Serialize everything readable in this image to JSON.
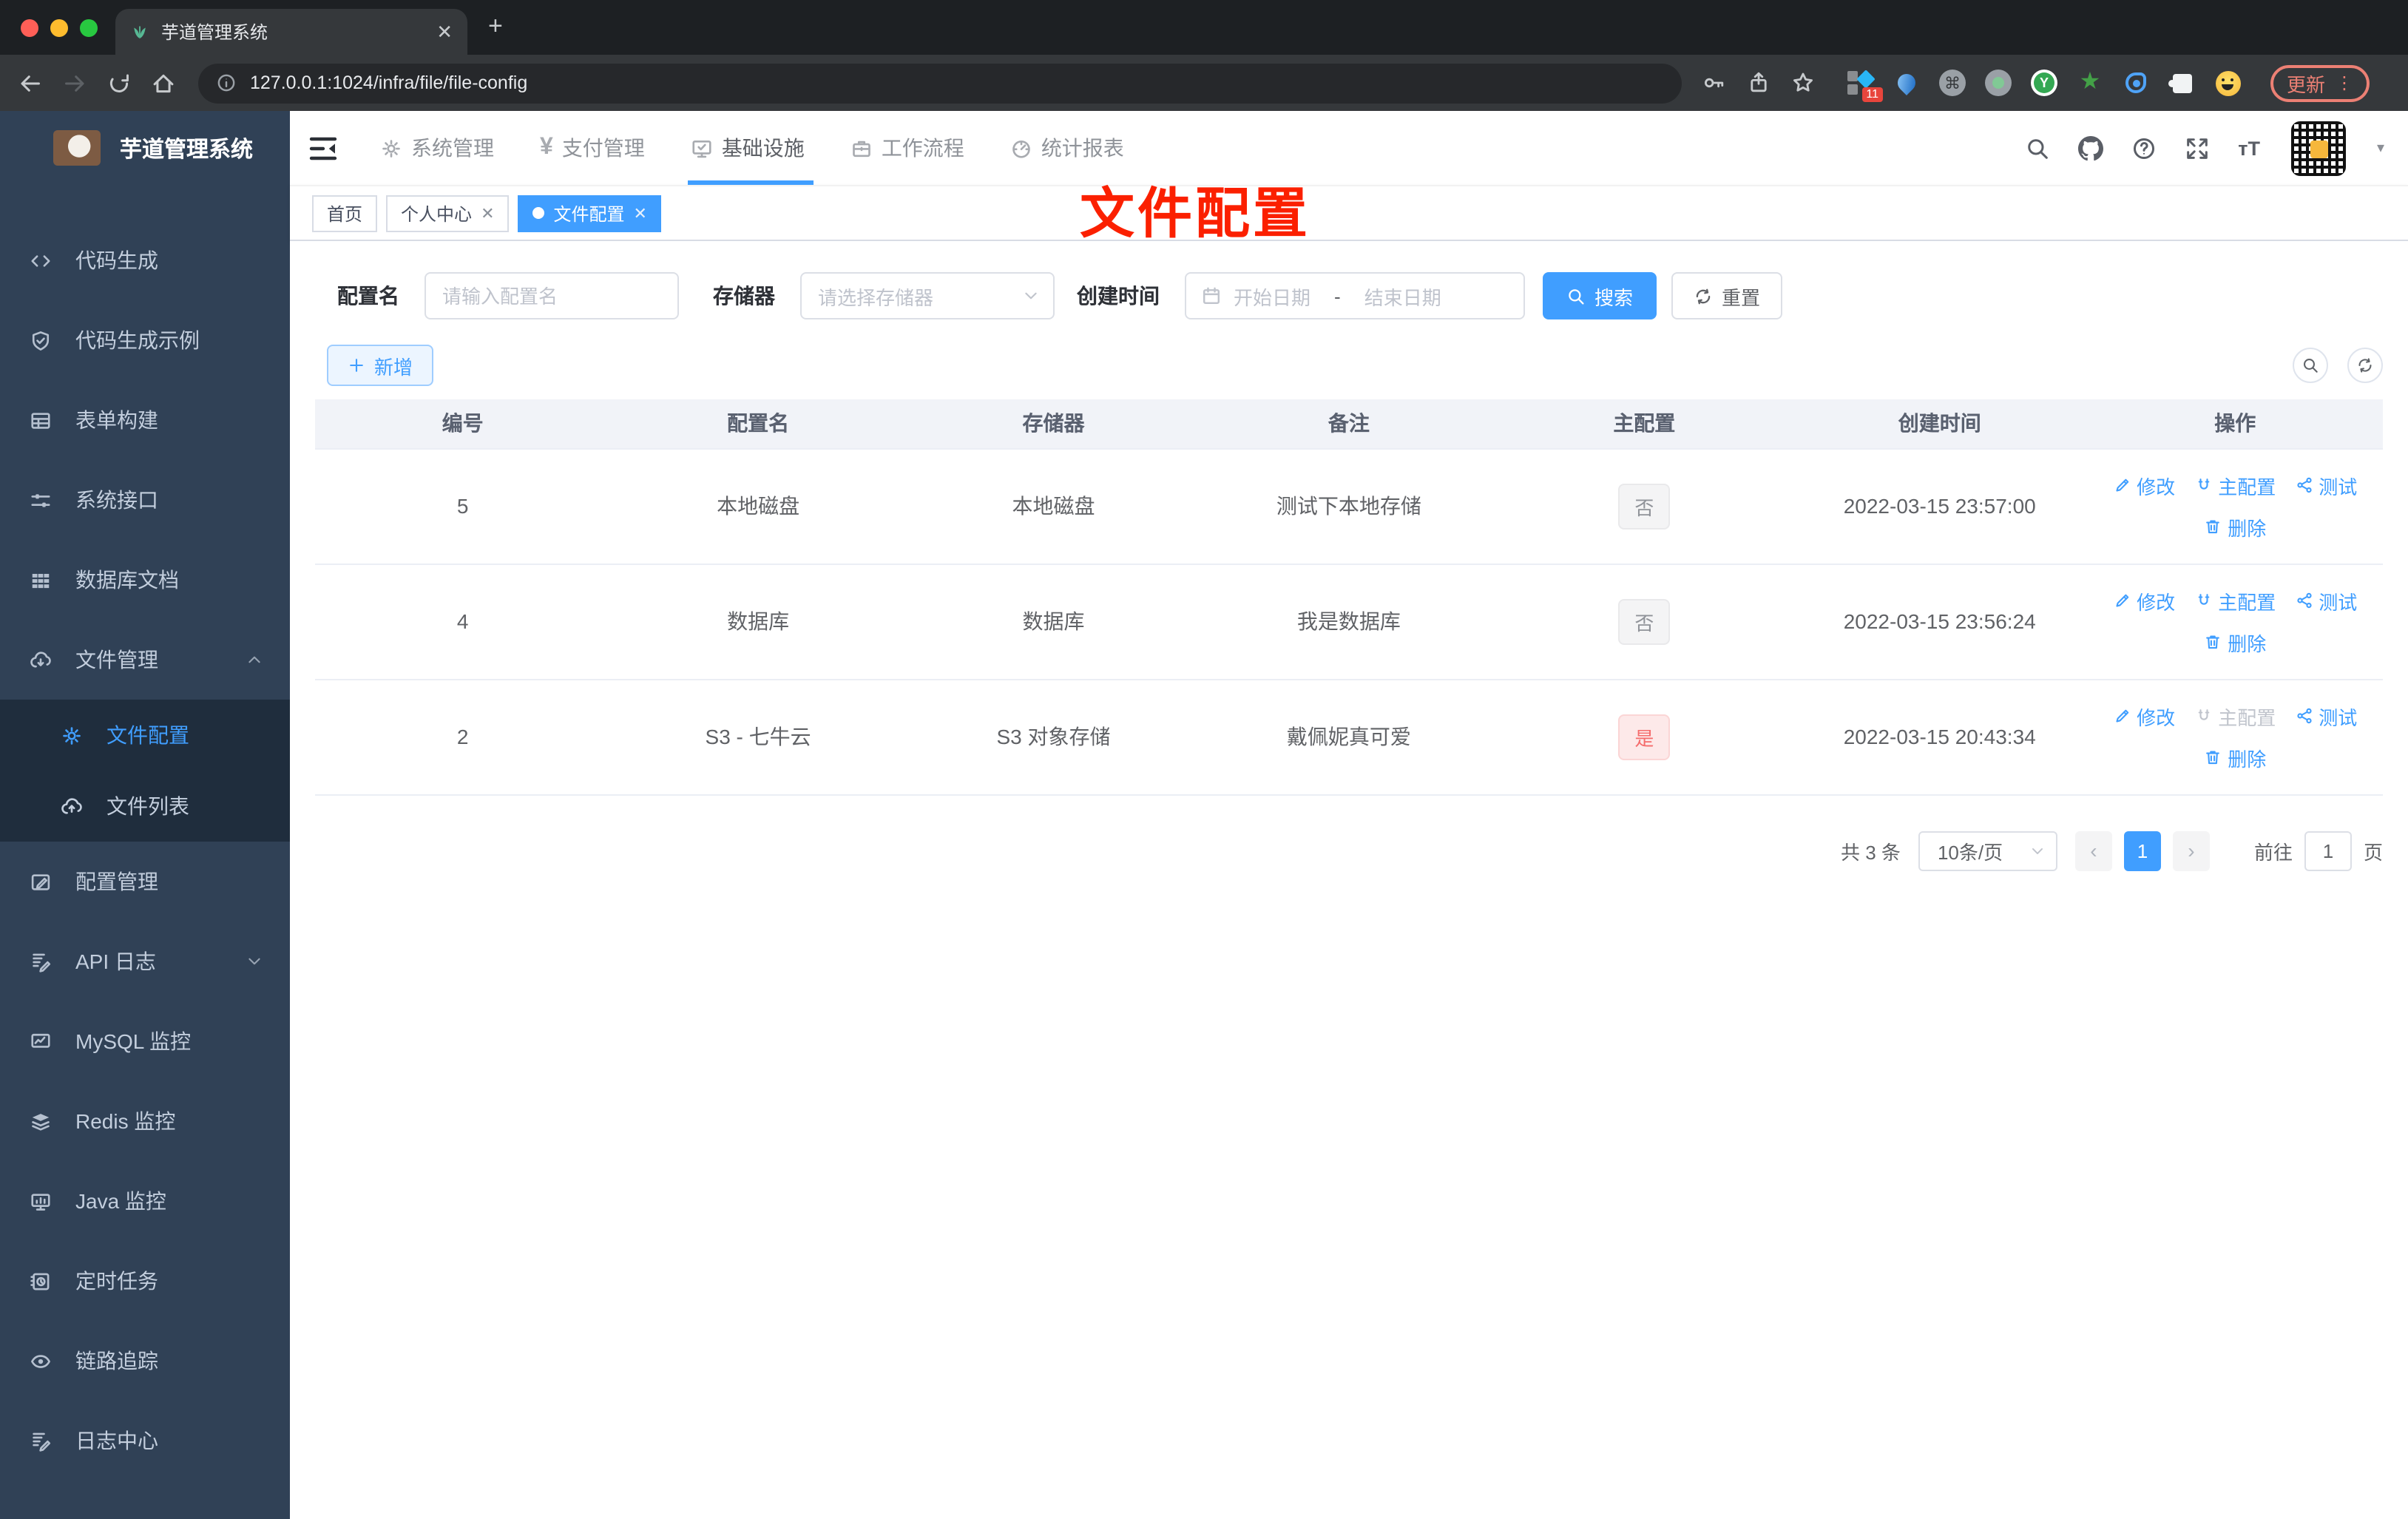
{
  "browser": {
    "tab_title": "芋道管理系统",
    "url": "127.0.0.1:1024/infra/file/file-config",
    "update_label": "更新",
    "extension_badge": "11"
  },
  "colors": {
    "accent": "#409eff",
    "danger": "#f56c6c",
    "sidebar_bg": "#304156",
    "submenu_bg": "#1f2d3d",
    "annotation_red": "#fb2000"
  },
  "top_nav": {
    "items": [
      {
        "label": "系统管理",
        "icon": "gear-icon"
      },
      {
        "label": "支付管理",
        "icon": "yen-icon"
      },
      {
        "label": "基础设施",
        "icon": "monitor-check-icon",
        "active": true
      },
      {
        "label": "工作流程",
        "icon": "briefcase-icon"
      },
      {
        "label": "统计报表",
        "icon": "gauge-icon"
      }
    ]
  },
  "sidebar": {
    "title": "芋道管理系统",
    "items": [
      {
        "label": "代码生成",
        "icon": "code-icon"
      },
      {
        "label": "代码生成示例",
        "icon": "shield-check-icon"
      },
      {
        "label": "表单构建",
        "icon": "form-table-icon"
      },
      {
        "label": "系统接口",
        "icon": "sliders-icon"
      },
      {
        "label": "数据库文档",
        "icon": "grid-icon"
      },
      {
        "label": "文件管理",
        "icon": "cloud-download-icon",
        "expanded": true,
        "children": [
          {
            "label": "文件配置",
            "icon": "gear-icon",
            "active": true
          },
          {
            "label": "文件列表",
            "icon": "cloud-upload-icon"
          }
        ]
      },
      {
        "label": "配置管理",
        "icon": "edit-square-icon"
      },
      {
        "label": "API 日志",
        "icon": "doc-edit-icon",
        "collapsed": true
      },
      {
        "label": "MySQL 监控",
        "icon": "chart-monitor-icon"
      },
      {
        "label": "Redis 监控",
        "icon": "layers-icon"
      },
      {
        "label": "Java 监控",
        "icon": "screen-icon"
      },
      {
        "label": "定时任务",
        "icon": "schedule-icon"
      },
      {
        "label": "链路追踪",
        "icon": "eye-icon"
      },
      {
        "label": "日志中心",
        "icon": "log-edit-icon"
      }
    ]
  },
  "tags": {
    "items": [
      {
        "label": "首页"
      },
      {
        "label": "个人中心",
        "closable": true
      },
      {
        "label": "文件配置",
        "closable": true,
        "active": true
      }
    ]
  },
  "annotation": {
    "text": "文件配置"
  },
  "filter": {
    "name_label": "配置名",
    "name_placeholder": "请输入配置名",
    "storage_label": "存储器",
    "storage_placeholder": "请选择存储器",
    "time_label": "创建时间",
    "start_placeholder": "开始日期",
    "separator": "-",
    "end_placeholder": "结束日期",
    "search_label": "搜索",
    "reset_label": "重置"
  },
  "toolbar": {
    "add_label": "新增"
  },
  "table": {
    "headers": [
      "编号",
      "配置名",
      "存储器",
      "备注",
      "主配置",
      "创建时间",
      "操作"
    ],
    "rows": [
      {
        "id": "5",
        "name": "本地磁盘",
        "storage": "本地磁盘",
        "remark": "测试下本地存储",
        "master": "否",
        "created": "2022-03-15 23:57:00"
      },
      {
        "id": "4",
        "name": "数据库",
        "storage": "数据库",
        "remark": "我是数据库",
        "master": "否",
        "created": "2022-03-15 23:56:24"
      },
      {
        "id": "2",
        "name": "S3 - 七牛云",
        "storage": "S3 对象存储",
        "remark": "戴佩妮真可爱",
        "master": "是",
        "created": "2022-03-15 20:43:34"
      }
    ]
  },
  "actions": {
    "edit": "修改",
    "master": "主配置",
    "test": "测试",
    "delete": "删除"
  },
  "pagination": {
    "total": "共 3 条",
    "page_size": "10条/页",
    "page": "1",
    "goto_label": "前往",
    "goto_value": "1",
    "page_unit": "页"
  }
}
